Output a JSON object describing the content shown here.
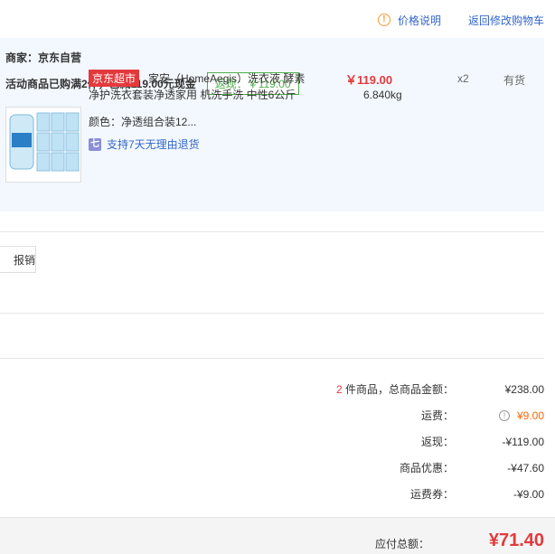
{
  "header": {
    "price_note": "价格说明",
    "back_link": "返回修改购物车"
  },
  "merchant": {
    "label": "商家：京东自营",
    "promo_text": "活动商品已购满2件，已减119.00元现金",
    "cashback": "返现：￥119.00"
  },
  "product": {
    "tag": "京东超市",
    "name_line1": "家安（HomeAegis）洗衣液 酵素",
    "name_line2": "净护洗衣套装净透家用 机洗手洗 中性6公斤",
    "price": "￥119.00",
    "weight": "6.840kg",
    "qty": "x2",
    "stock": "有货",
    "color": "颜色：净透组合装12...",
    "return_icon": "七",
    "return_policy": "支持7天无理由退货"
  },
  "invoice": {
    "button_label": "报销"
  },
  "summary": {
    "count": "2",
    "count_label": " 件商品，总商品金额：",
    "goods_total": "¥238.00",
    "freight_label": "运费：",
    "freight_value": "¥9.00",
    "cashback_label": "返现：",
    "cashback_value": "-¥119.00",
    "discount_label": "商品优惠：",
    "discount_value": "-¥47.60",
    "freight_coupon_label": "运费券：",
    "freight_coupon_value": "-¥9.00",
    "total_label": "应付总额：",
    "total_value": "¥71.40"
  },
  "colors": {
    "accent_red": "#e4393c",
    "link_blue": "#3366cc",
    "cashback_green": "#4cae4c",
    "freight_orange": "#ff6600"
  },
  "icons": [
    "info-icon",
    "seven-day-return-icon",
    "freight-help-icon"
  ]
}
